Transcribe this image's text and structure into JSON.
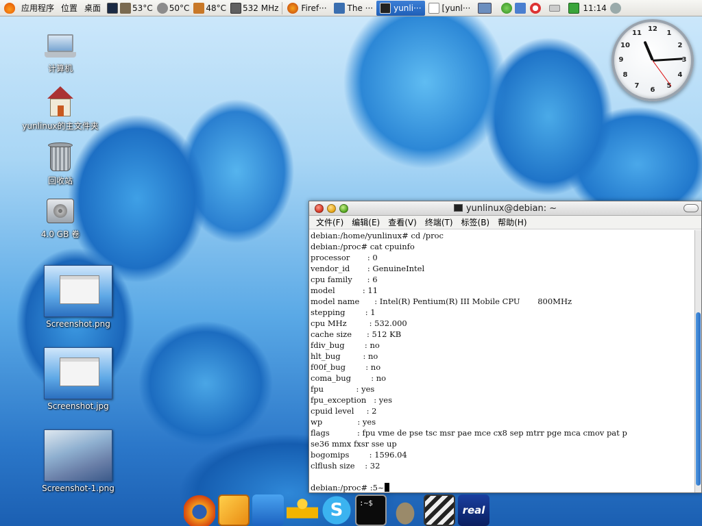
{
  "top_panel": {
    "menus": [
      "应用程序",
      "位置",
      "桌面"
    ],
    "sensors": [
      "53°C",
      "50°C",
      "48°C"
    ],
    "cpu_freq": "532 MHz",
    "tasks": [
      {
        "label": "Firef···",
        "active": false
      },
      {
        "label": "The ···",
        "active": false
      },
      {
        "label": "yunli···",
        "active": true
      },
      {
        "label": "[yunl···",
        "active": false
      }
    ],
    "clock": "11:14"
  },
  "desktop_icons": [
    {
      "label": "计算机",
      "icon": "computer-icon"
    },
    {
      "label": "yunlinux的主文件夹",
      "icon": "home-folder-icon"
    },
    {
      "label": "回收站",
      "icon": "trash-icon"
    },
    {
      "label": "4.0 GB 卷",
      "icon": "drive-icon"
    },
    {
      "label": "Screenshot.png",
      "icon": "image-thumbnail"
    },
    {
      "label": "Screenshot.jpg",
      "icon": "image-thumbnail"
    },
    {
      "label": "Screenshot-1.png",
      "icon": "image-thumbnail"
    }
  ],
  "clock_widget": {
    "numbers": [
      "12",
      "1",
      "2",
      "3",
      "4",
      "5",
      "6",
      "7",
      "8",
      "9",
      "10",
      "11"
    ],
    "hour": 11,
    "minute": 14,
    "second": 24
  },
  "terminal": {
    "title": "yunlinux@debian: ~",
    "menu": [
      "文件(F)",
      "编辑(E)",
      "查看(V)",
      "终端(T)",
      "标签(B)",
      "帮助(H)"
    ],
    "lines": [
      "debian:/home/yunlinux# cd /proc",
      "debian:/proc# cat cpuinfo",
      "processor       : 0",
      "vendor_id       : GenuineIntel",
      "cpu family      : 6",
      "model           : 11",
      "model name      : Intel(R) Pentium(R) III Mobile CPU       800MHz",
      "stepping        : 1",
      "cpu MHz         : 532.000",
      "cache size      : 512 KB",
      "fdiv_bug        : no",
      "hlt_bug         : no",
      "f00f_bug        : no",
      "coma_bug        : no",
      "fpu             : yes",
      "fpu_exception   : yes",
      "cpuid level     : 2",
      "wp              : yes",
      "flags           : fpu vme de pse tsc msr pae mce cx8 sep mtrr pge mca cmov pat p",
      "se36 mmx fxsr sse up",
      "bogomips        : 1596.04",
      "clflush size    : 32",
      "",
      "debian:/proc# :5~"
    ]
  },
  "dock": [
    {
      "name": "firefox-icon"
    },
    {
      "name": "file-manager-icon"
    },
    {
      "name": "text-editor-icon"
    },
    {
      "name": "messenger-icon"
    },
    {
      "name": "skype-icon"
    },
    {
      "name": "terminal-icon",
      "text": ":~$"
    },
    {
      "name": "gimp-icon"
    },
    {
      "name": "video-editor-icon"
    },
    {
      "name": "realplayer-icon",
      "text": "real"
    }
  ]
}
